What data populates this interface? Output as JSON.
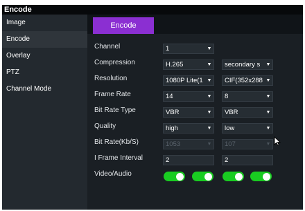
{
  "title": "Encode",
  "sidebar": {
    "items": [
      {
        "label": "Image"
      },
      {
        "label": "Encode"
      },
      {
        "label": "Overlay"
      },
      {
        "label": "PTZ"
      },
      {
        "label": "Channel Mode"
      }
    ]
  },
  "tab": {
    "label": "Encode"
  },
  "form": {
    "channel": {
      "label": "Channel",
      "value": "1"
    },
    "compression": {
      "label": "Compression",
      "main": "H.265",
      "sub": "secondary s"
    },
    "resolution": {
      "label": "Resolution",
      "main": "1080P Lite(1",
      "sub": "CIF(352x288"
    },
    "frame_rate": {
      "label": "Frame Rate",
      "main": "14",
      "sub": "8"
    },
    "bit_rate_type": {
      "label": "Bit Rate Type",
      "main": "VBR",
      "sub": "VBR"
    },
    "quality": {
      "label": "Quality",
      "main": "high",
      "sub": "low"
    },
    "bit_rate": {
      "label": "Bit Rate(Kb/S)",
      "main": "1053",
      "sub": "107"
    },
    "i_frame": {
      "label": "I Frame Interval",
      "main": "2",
      "sub": "2"
    },
    "video_audio": {
      "label": "Video/Audio",
      "toggles": [
        true,
        true,
        true,
        true
      ]
    }
  },
  "colors": {
    "accent": "#8b2fd2",
    "toggle_on": "#19cc21",
    "window_bg": "#0f1317"
  }
}
